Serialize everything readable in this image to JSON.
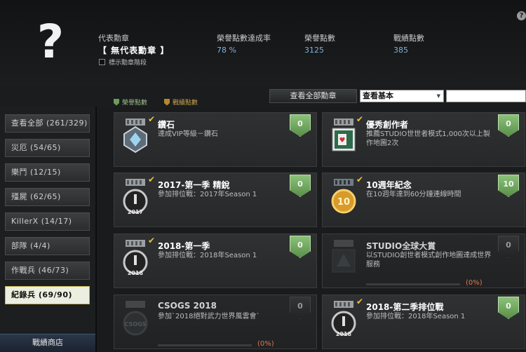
{
  "header": {
    "rep_label": "代表勳章",
    "rep_value": "【 無代表勳章 】",
    "checkbox_label": "標示勳章階段",
    "stats": [
      {
        "label": "榮譽點數達成率",
        "value": "78 %"
      },
      {
        "label": "榮譽點數",
        "value": "3125"
      },
      {
        "label": "戰績點數",
        "value": "385"
      }
    ],
    "help": "?"
  },
  "toolbar": {
    "legend_honor": "榮譽點數",
    "legend_battle": "戰績點數",
    "view_all": "查看全部勳章",
    "filter_selected": "查看基本"
  },
  "sidebar": {
    "items": [
      {
        "label": "查看全部 (261/329)"
      },
      {
        "label": "災厄 (54/65)"
      },
      {
        "label": "樂鬥 (12/15)"
      },
      {
        "label": "殭屍 (62/65)"
      },
      {
        "label": "KillerX (14/17)"
      },
      {
        "label": "部隊 (4/4)"
      },
      {
        "label": "作戰兵 (46/73)"
      },
      {
        "label": "紀錄兵 (69/90)"
      }
    ],
    "shop": "戰績商店"
  },
  "medals": [
    {
      "title": "鑽石",
      "desc": "達成VIP等級－鑽石",
      "points": "0",
      "done": true,
      "locked": false
    },
    {
      "title": "優秀創作者",
      "desc": "推薦STUDIO世世者模式1,000次以上製作地圖2次",
      "points": "0",
      "done": true,
      "locked": false
    },
    {
      "title": "2017-第一季 精銳",
      "desc": "參加排位戰：2017年Season 1",
      "points": "0",
      "done": true,
      "locked": false,
      "year": "2017"
    },
    {
      "title": "10週年紀念",
      "desc": "在10週年達到60分鐘連線時間",
      "points": "10",
      "done": true,
      "locked": false
    },
    {
      "title": "2018-第一季",
      "desc": "參加排位戰：2018年Season 1",
      "points": "0",
      "done": true,
      "locked": false,
      "year": "2018"
    },
    {
      "title": "STUDIO全球大賞",
      "desc": "以STUDIO創世者模式創作地圖達成世界服務",
      "points": "0",
      "done": false,
      "locked": true,
      "progress": "(0%)"
    },
    {
      "title": "CSOGS 2018",
      "desc": "參加`2018絕對武力世界風雲會`",
      "points": "0",
      "done": false,
      "locked": true,
      "progress": "(0%)"
    },
    {
      "title": "2018-第二季排位戰",
      "desc": "參加排位戰：2018年Season 1",
      "points": "0",
      "done": true,
      "locked": false,
      "year": "2018"
    }
  ],
  "colors": {
    "accent_green": "#6e9a5b",
    "gold": "#f0c23a",
    "progress_orange": "#e07850"
  }
}
